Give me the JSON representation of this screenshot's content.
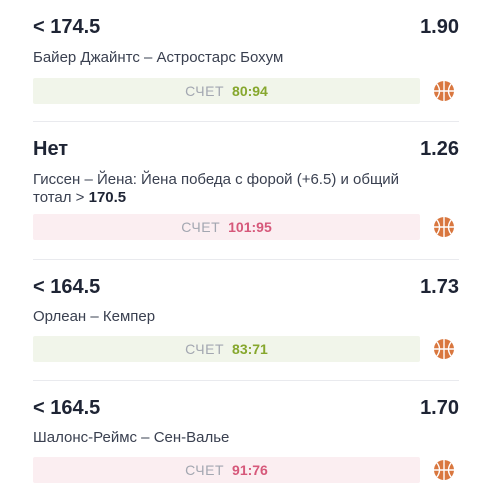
{
  "bets": [
    {
      "pick": "< 174.5",
      "odds": "1.90",
      "match": "Байер Джайнтс – Астростарс Бохум",
      "score_label": "СЧЕТ",
      "score": "80:94",
      "result": "win",
      "sport_icon": "basketball-icon"
    },
    {
      "pick": "Нет",
      "odds": "1.26",
      "match_line1": "Гиссен – Йена: Йена победа с форой (+6.5) и общий",
      "match_line2_prefix": "тотал > ",
      "match_line2_value": "170.5",
      "score_label": "СЧЕТ",
      "score": "101:95",
      "result": "loss",
      "sport_icon": "basketball-icon"
    },
    {
      "pick": "< 164.5",
      "odds": "1.73",
      "match": "Орлеан – Кемпер",
      "score_label": "СЧЕТ",
      "score": "83:71",
      "result": "win",
      "sport_icon": "basketball-icon"
    },
    {
      "pick": "< 164.5",
      "odds": "1.70",
      "match": "Шалонс-Реймс – Сен-Валье",
      "score_label": "СЧЕТ",
      "score": "91:76",
      "result": "loss",
      "sport_icon": "basketball-icon"
    }
  ],
  "colors": {
    "win_text": "#86a72d",
    "win_bg": "#f1f5ea",
    "loss_text": "#d6587a",
    "loss_bg": "#fbeef1",
    "ball": "#d9773f"
  }
}
